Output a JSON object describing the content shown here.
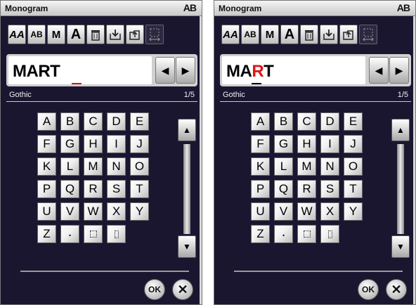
{
  "screens": [
    {
      "title": "Monogram",
      "corner_label": "AB",
      "toolbar": {
        "tool_1": "A",
        "tool_2": "AB",
        "tool_3": "M",
        "tool_4": "A"
      },
      "text_before": "MART",
      "text_highlight": "",
      "text_after": "",
      "arrow_left": "◀",
      "arrow_right": "▶",
      "font_name": "Gothic",
      "page_indicator": "1/5",
      "keys": [
        "A",
        "B",
        "C",
        "D",
        "E",
        "F",
        "G",
        "H",
        "I",
        "J",
        "K",
        "L",
        "M",
        "N",
        "O",
        "P",
        "Q",
        "R",
        "S",
        "T",
        "U",
        "V",
        "W",
        "X",
        "Y",
        "Z",
        "."
      ],
      "scroll_up": "▲",
      "scroll_down": "▼",
      "ok_label": "OK",
      "cancel_label": "✕",
      "colors": {
        "cursor": "#e01515",
        "highlight": "#e01515"
      }
    },
    {
      "title": "Monogram",
      "corner_label": "AB",
      "toolbar": {
        "tool_1": "A",
        "tool_2": "AB",
        "tool_3": "M",
        "tool_4": "A"
      },
      "text_before": "MA",
      "text_highlight": "R",
      "text_after": "T",
      "arrow_left": "◀",
      "arrow_right": "▶",
      "font_name": "Gothic",
      "page_indicator": "1/5",
      "keys": [
        "A",
        "B",
        "C",
        "D",
        "E",
        "F",
        "G",
        "H",
        "I",
        "J",
        "K",
        "L",
        "M",
        "N",
        "O",
        "P",
        "Q",
        "R",
        "S",
        "T",
        "U",
        "V",
        "W",
        "X",
        "Y",
        "Z",
        "."
      ],
      "scroll_up": "▲",
      "scroll_down": "▼",
      "ok_label": "OK",
      "cancel_label": "✕",
      "colors": {
        "cursor": "#000000",
        "highlight": "#e01515"
      }
    }
  ],
  "icons": [
    "font-size-icon",
    "multi-color-icon",
    "spacing-icon",
    "letter-size-icon",
    "delete-icon",
    "save-icon",
    "open-icon",
    "layout-icon",
    "blank-space-icon",
    "narrow-space-icon"
  ]
}
